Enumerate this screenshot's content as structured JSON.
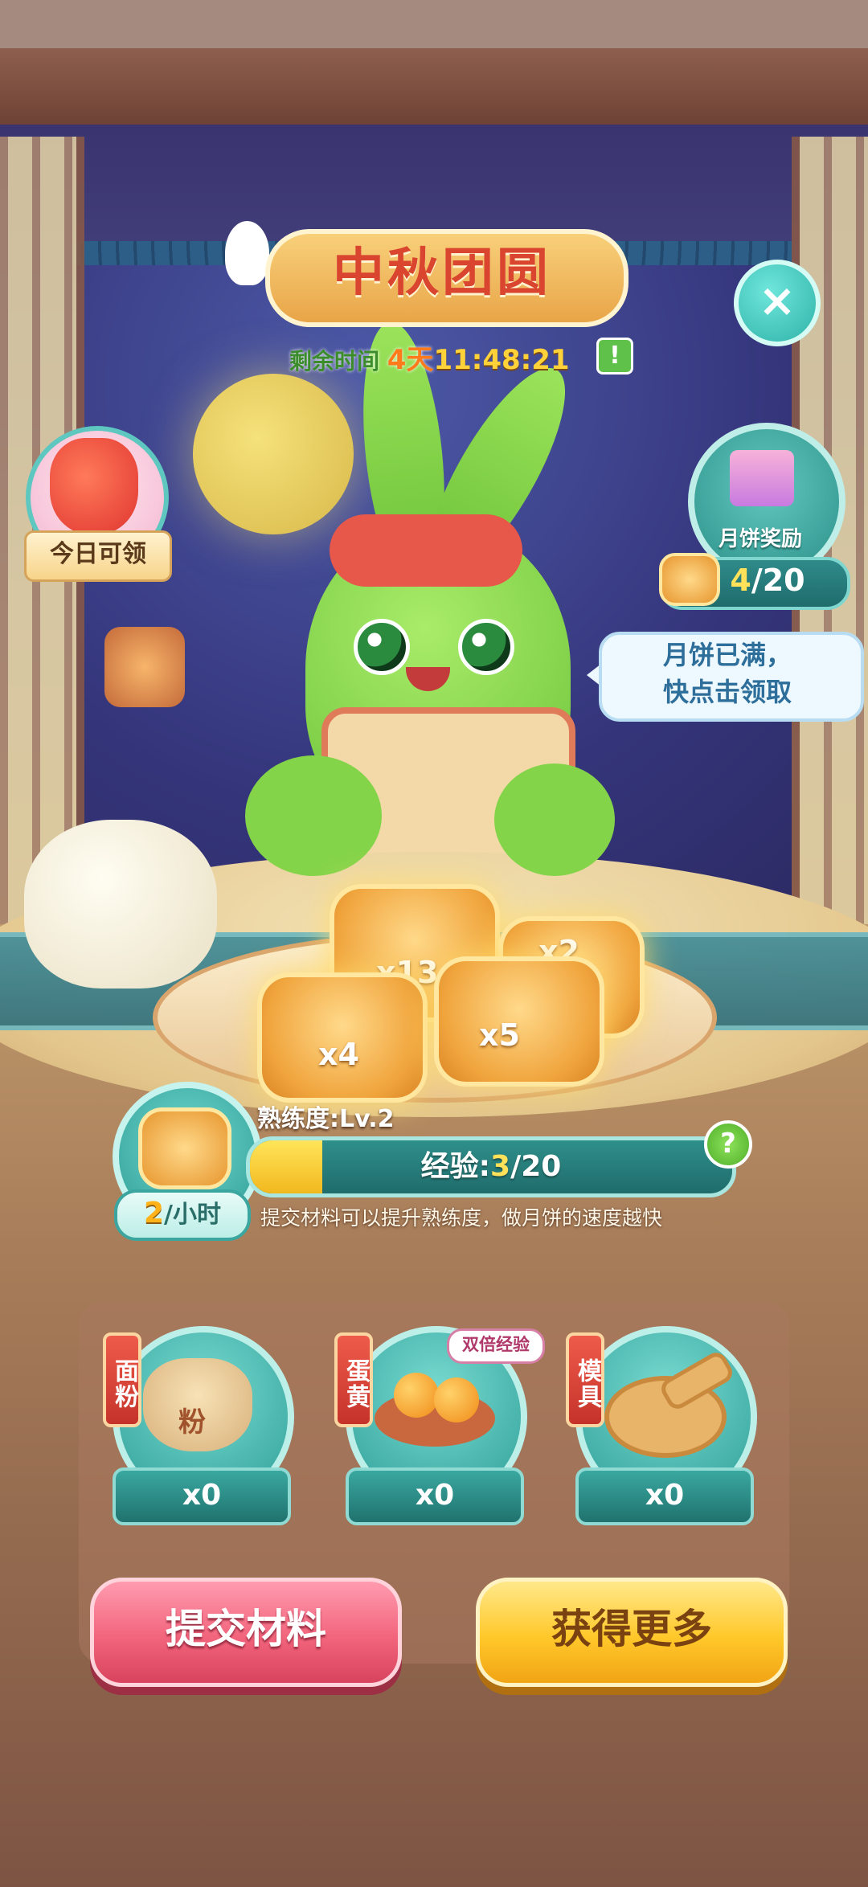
{
  "event": {
    "title": "中秋团圆",
    "timer_label": "剩余时间",
    "timer_days": "4天",
    "timer_time": "11:48:21",
    "alert_icon": "!",
    "close_icon": "×"
  },
  "daily_gift": {
    "label": "今日可领"
  },
  "mooncake_reward": {
    "label": "月饼奖励",
    "current": "4",
    "total": "/20",
    "progress_fraction": 0.2
  },
  "bubble": {
    "line1": "月饼已满，",
    "line2": "快点击领取"
  },
  "mooncakes": [
    {
      "count": "x13"
    },
    {
      "count": "x2"
    },
    {
      "count": "x4"
    },
    {
      "count": "x5"
    }
  ],
  "proficiency": {
    "level_label": "熟练度:",
    "level_value": "Lv.2",
    "rate_value": "2",
    "rate_unit": "/小时",
    "exp_label": "经验:",
    "exp_current": "3",
    "exp_total": "/20",
    "exp_fraction": 0.15,
    "help_icon": "?",
    "hint": "提交材料可以提升熟练度，做月饼的速度越快"
  },
  "materials": [
    {
      "tag": "面粉",
      "count": "x0",
      "icon": "flour-sack-icon",
      "icon_text": "粉"
    },
    {
      "tag": "蛋黄",
      "count": "x0",
      "icon": "egg-yolk-icon",
      "badge": "双倍经验"
    },
    {
      "tag": "模具",
      "count": "x0",
      "icon": "mooncake-mold-icon"
    }
  ],
  "buttons": {
    "submit": "提交材料",
    "get_more": "获得更多"
  },
  "colors": {
    "pink_button": "#f2657c",
    "yellow_button": "#ffc82a",
    "teal": "#2e9f98",
    "title_red": "#d9452f"
  }
}
